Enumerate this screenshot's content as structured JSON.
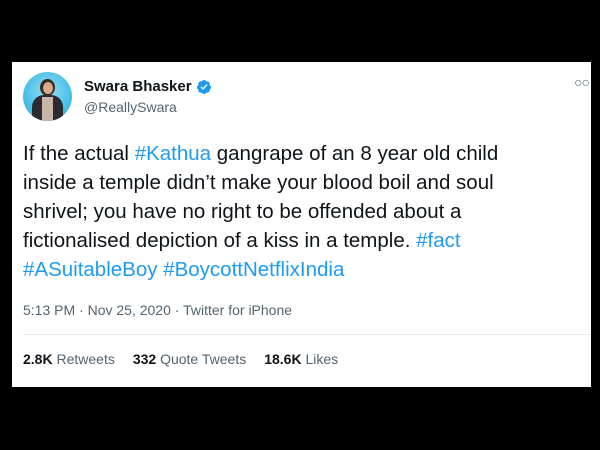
{
  "tweet": {
    "author": {
      "display_name": "Swara Bhasker",
      "handle": "@ReallySwara",
      "verified": true
    },
    "text_lines": [
      [
        {
          "text": "If the actual "
        },
        {
          "text": "#Kathua",
          "hashtag": true
        },
        {
          "text": " gangrape of an 8 year old child"
        }
      ],
      [
        {
          "text": "inside a temple didn’t make your blood boil and soul"
        }
      ],
      [
        {
          "text": "shrivel; you have no right to be offended about a"
        }
      ],
      [
        {
          "text": "fictionalised depiction of a kiss in a temple. "
        },
        {
          "text": "#fact",
          "hashtag": true
        }
      ],
      [
        {
          "text": "#ASuitableBoy",
          "hashtag": true
        },
        {
          "text": " "
        },
        {
          "text": "#BoycottNetflixIndia",
          "hashtag": true
        }
      ]
    ],
    "time": "5:13 PM",
    "separator": " · ",
    "date": "Nov 25, 2020",
    "source": "Twitter for iPhone",
    "stats": {
      "retweets_count": "2.8K",
      "retweets_label": "Retweets",
      "quote_tweets_count": "332",
      "quote_tweets_label": "Quote Tweets",
      "likes_count": "18.6K",
      "likes_label": "Likes"
    },
    "more_icon": "more-options-icon"
  },
  "colors": {
    "background": "#000000",
    "card": "#ffffff",
    "hashtag": "#1d9bf0",
    "verified": "#1d9bf0",
    "secondary_text": "#536471",
    "primary_text": "#0f1419"
  }
}
